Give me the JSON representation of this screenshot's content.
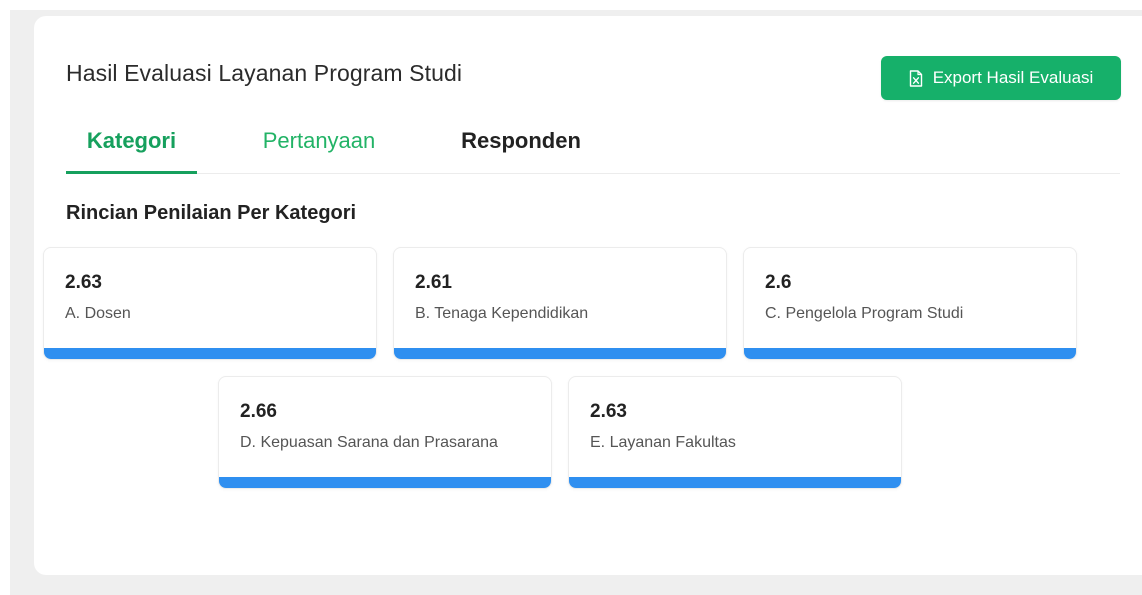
{
  "header": {
    "title": "Hasil Evaluasi Layanan Program Studi",
    "export_label": "Export Hasil Evaluasi",
    "export_icon": "excel-file-icon"
  },
  "tabs": [
    {
      "label": "Kategori",
      "active": true
    },
    {
      "label": "Pertanyaan",
      "active": false
    },
    {
      "label": "Responden",
      "active": false
    }
  ],
  "section": {
    "title": "Rincian Penilaian Per Kategori"
  },
  "categories": [
    {
      "score": "2.63",
      "label": "A. Dosen"
    },
    {
      "score": "2.61",
      "label": "B. Tenaga Kependidikan"
    },
    {
      "score": "2.6",
      "label": "C. Pengelola Program Studi"
    },
    {
      "score": "2.66",
      "label": "D. Kepuasan Sarana dan Prasarana"
    },
    {
      "score": "2.63",
      "label": "E. Layanan Fakultas"
    }
  ],
  "colors": {
    "primary_green": "#16b06a",
    "tab_active": "#16a05d",
    "accent_blue": "#2f8ff0"
  }
}
